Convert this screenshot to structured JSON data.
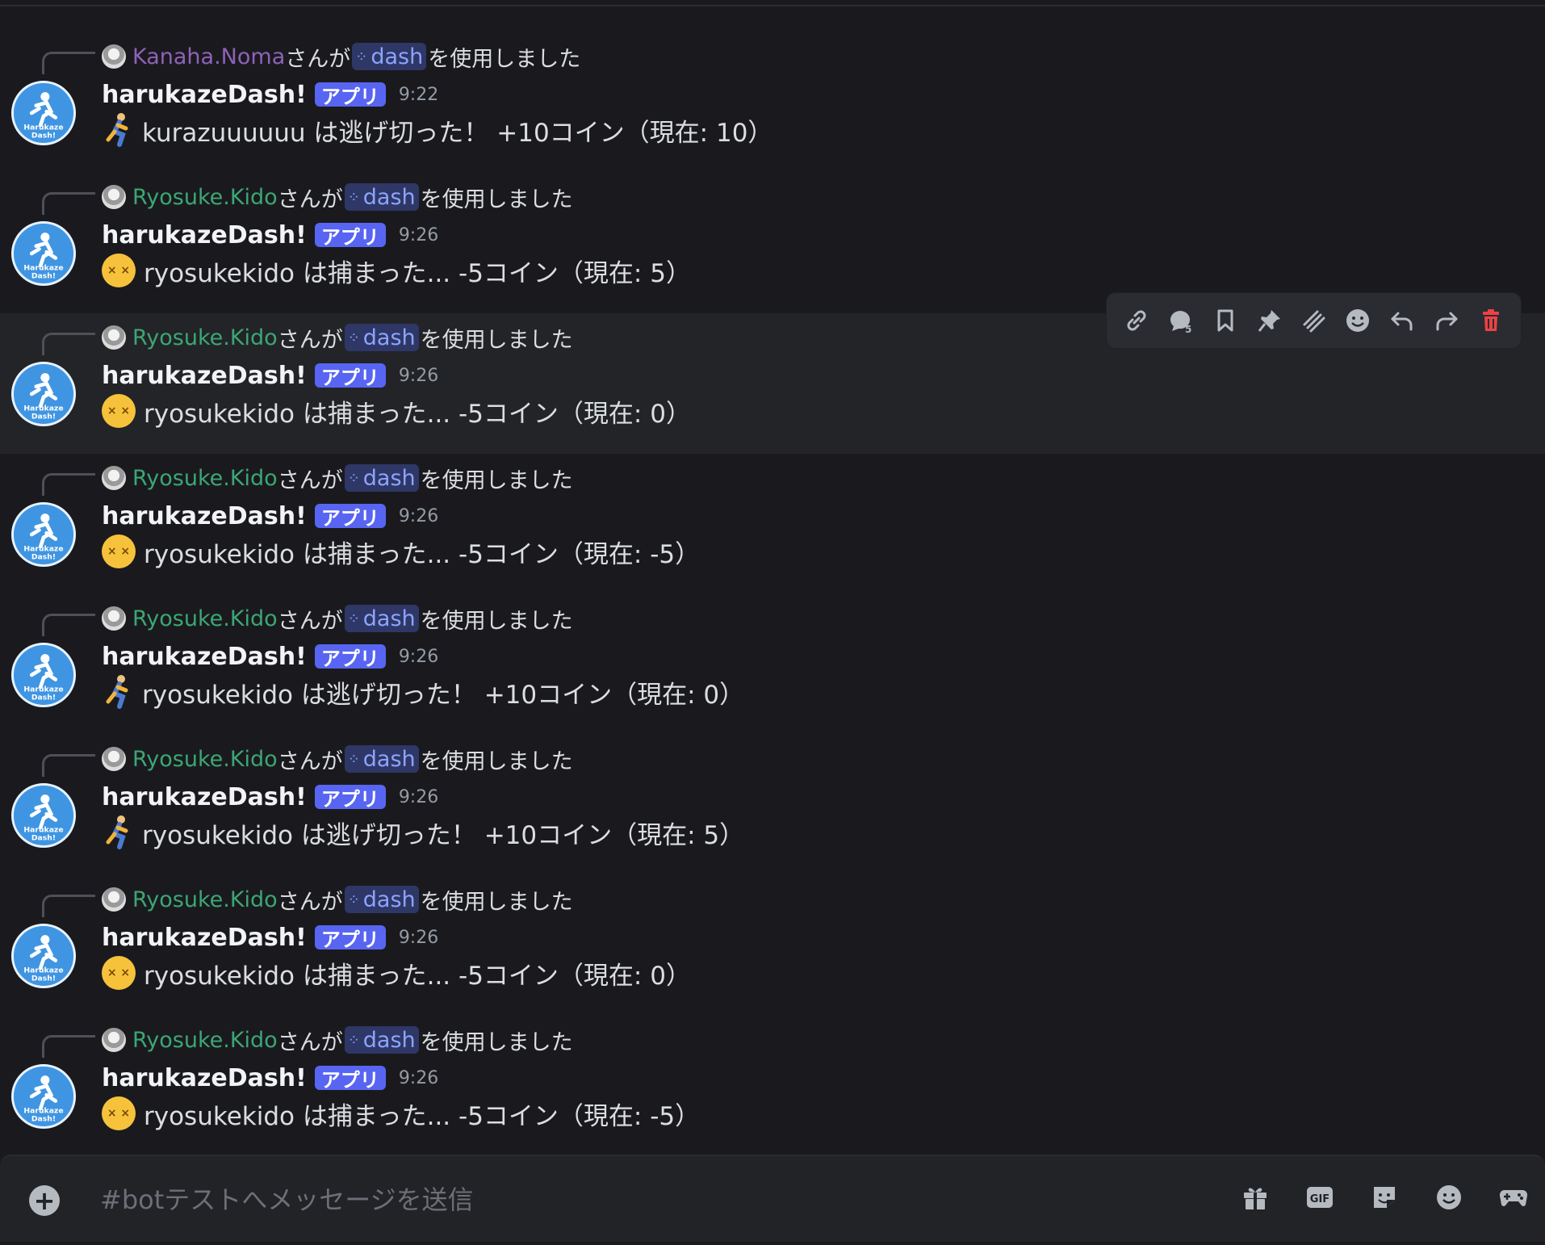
{
  "command": "dash",
  "bot": {
    "name": "harukazeDash!",
    "tag": "アプリ",
    "avatar_text": "Harukaze Dash!"
  },
  "messages": [
    {
      "reply_user": "Kanaha.Noma",
      "reply_suffix": "さんが",
      "reply_action": "を使用しました",
      "time": "9:22",
      "emoji": "runner",
      "text": "kurazuuuuuu は逃げ切った！ +10コイン（現在: 10）"
    },
    {
      "reply_user": "Ryosuke.Kido",
      "reply_suffix": "さんが",
      "reply_action": "を使用しました",
      "time": "9:26",
      "emoji": "dizzy",
      "text": "ryosukekido は捕まった... -5コイン（現在: 5）"
    },
    {
      "reply_user": "Ryosuke.Kido",
      "reply_suffix": "さんが",
      "reply_action": "を使用しました",
      "time": "9:26",
      "emoji": "dizzy",
      "text": "ryosukekido は捕まった... -5コイン（現在: 0）"
    },
    {
      "reply_user": "Ryosuke.Kido",
      "reply_suffix": "さんが",
      "reply_action": "を使用しました",
      "time": "9:26",
      "emoji": "dizzy",
      "text": "ryosukekido は捕まった... -5コイン（現在: -5）"
    },
    {
      "reply_user": "Ryosuke.Kido",
      "reply_suffix": "さんが",
      "reply_action": "を使用しました",
      "time": "9:26",
      "emoji": "runner",
      "text": "ryosukekido は逃げ切った！ +10コイン（現在: 0）"
    },
    {
      "reply_user": "Ryosuke.Kido",
      "reply_suffix": "さんが",
      "reply_action": "を使用しました",
      "time": "9:26",
      "emoji": "runner",
      "text": "ryosukekido は逃げ切った！ +10コイン（現在: 5）"
    },
    {
      "reply_user": "Ryosuke.Kido",
      "reply_suffix": "さんが",
      "reply_action": "を使用しました",
      "time": "9:26",
      "emoji": "dizzy",
      "text": "ryosukekido は捕まった... -5コイン（現在: 0）"
    },
    {
      "reply_user": "Ryosuke.Kido",
      "reply_suffix": "さんが",
      "reply_action": "を使用しました",
      "time": "9:26",
      "emoji": "dizzy",
      "text": "ryosukekido は捕まった... -5コイン（現在: -5）"
    }
  ],
  "toolbar": [
    "link-icon",
    "thread-reply-icon",
    "bookmark-icon",
    "pin-icon",
    "mark-unread-icon",
    "reaction-icon",
    "reply-icon",
    "forward-icon",
    "delete-icon"
  ],
  "composer": {
    "placeholder": "#botテストへメッセージを送信",
    "gif_label": "GIF"
  },
  "colors": {
    "kanaha": "#8e62b8",
    "ryosuke": "#3ba774",
    "app_tag": "#5865f2",
    "delete": "#ed4245"
  }
}
